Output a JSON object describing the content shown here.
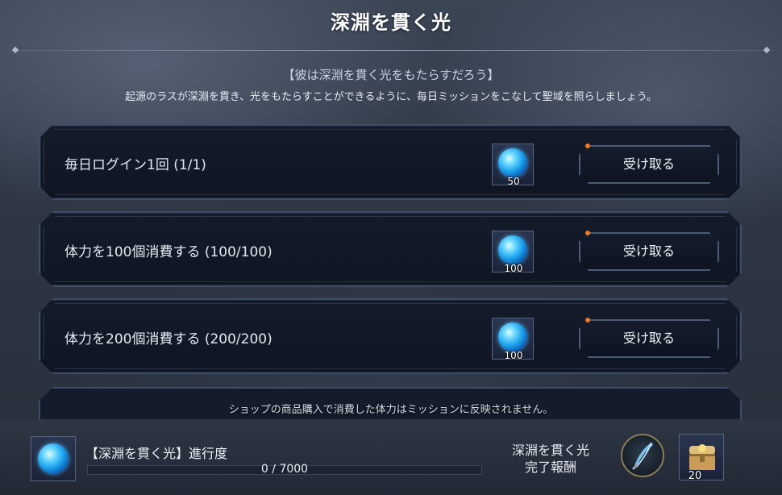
{
  "header": {
    "title": "深淵を貫く光"
  },
  "intro": {
    "subtitle": "【彼は深淵を貫く光をもたらすだろう】",
    "description": "起源のラスが深淵を貫き、光をもたらすことができるように、毎日ミッションをこなして聖域を照らしましょう。"
  },
  "missions": [
    {
      "label": "毎日ログイン1回 (1/1)",
      "reward_icon": "blue-orb-icon",
      "reward_count": "50",
      "button_label": "受け取る"
    },
    {
      "label": "体力を100個消費する (100/100)",
      "reward_icon": "blue-orb-icon",
      "reward_count": "100",
      "button_label": "受け取る"
    },
    {
      "label": "体力を200個消費する (200/200)",
      "reward_icon": "blue-orb-icon",
      "reward_count": "100",
      "button_label": "受け取る"
    }
  ],
  "notice": "ショップの商品購入で消費した体力はミッションに反映されません。",
  "progress": {
    "title": "【深淵を貫く光】進行度",
    "text": "0 / 7000",
    "current": 0,
    "max": 7000
  },
  "final_reward": {
    "label_line1": "深淵を貫く光",
    "label_line2": "完了報酬",
    "items": [
      {
        "icon": "feather-emblem-icon"
      },
      {
        "icon": "treasure-chest-icon",
        "count": "20"
      }
    ]
  },
  "colors": {
    "accent_dot": "#f07a24",
    "orb_blue": "#1fa6f0",
    "panel_border": "#3e4d66"
  }
}
